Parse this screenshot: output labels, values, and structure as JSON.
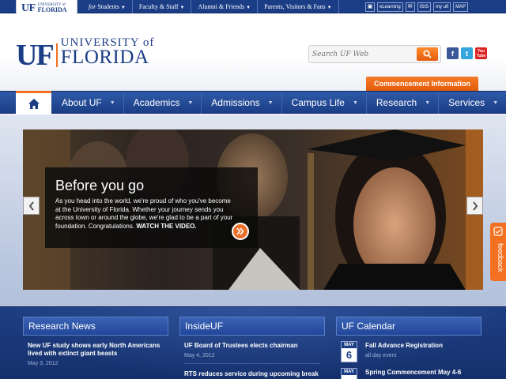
{
  "topbar": {
    "links": [
      {
        "prefix": "for",
        "label": "Students"
      },
      {
        "prefix": "",
        "label": "Faculty & Staff"
      },
      {
        "prefix": "",
        "label": "Alumni & Friends"
      },
      {
        "prefix": "",
        "label": "Parents, Visitors & Fans"
      }
    ],
    "icons": [
      "ISIS",
      "eLearning",
      "Email",
      "ISIS",
      "myUFL",
      "MAP"
    ],
    "icon_labels": {
      "elearning": "eLearning",
      "isis": "ISIS",
      "myufl": "my ufl",
      "map": "MAP"
    }
  },
  "brand": {
    "mini_uf": "UF",
    "mini_line1": "UNIVERSITY of",
    "mini_line2": "FLORIDA",
    "uf": "UF",
    "university": "UNIVERSITY of",
    "florida": "FLORIDA"
  },
  "search": {
    "placeholder": "Search UF Web"
  },
  "social": [
    "f",
    "t",
    "You Tube"
  ],
  "commencement": "Commencement Information",
  "nav": {
    "items": [
      "About UF",
      "Academics",
      "Admissions",
      "Campus Life",
      "Research",
      "Services"
    ]
  },
  "hero": {
    "title": "Before you go",
    "body": "As you head into the world, we're proud of who you've become at the University of Florida. Whether your journey sends you across town or around the globe, we're glad to be a part of your foundation. Congratulations.",
    "watch": "WATCH THE VIDEO."
  },
  "feedback": "feedback",
  "columns": {
    "research": {
      "heading": "Research News",
      "items": [
        {
          "title": "New UF study shows early North Americans lived with extinct giant beasts",
          "date": "May 3, 2012"
        }
      ]
    },
    "insideuf": {
      "heading": "InsideUF",
      "items": [
        {
          "title": "UF Board of Trustees elects chairman",
          "date": "May 4, 2012"
        },
        {
          "title": "RTS reduces service during upcoming break",
          "date": ""
        }
      ]
    },
    "calendar": {
      "heading": "UF Calendar",
      "items": [
        {
          "month": "MAY",
          "day": "6",
          "title": "Fall Advance Registration",
          "sub": "all day event"
        },
        {
          "month": "MAY",
          "day": "",
          "title": "Spring Commencement May 4-6",
          "sub": ""
        }
      ]
    }
  },
  "colors": {
    "brand_blue": "#1b3d86",
    "brand_orange": "#f37021"
  }
}
